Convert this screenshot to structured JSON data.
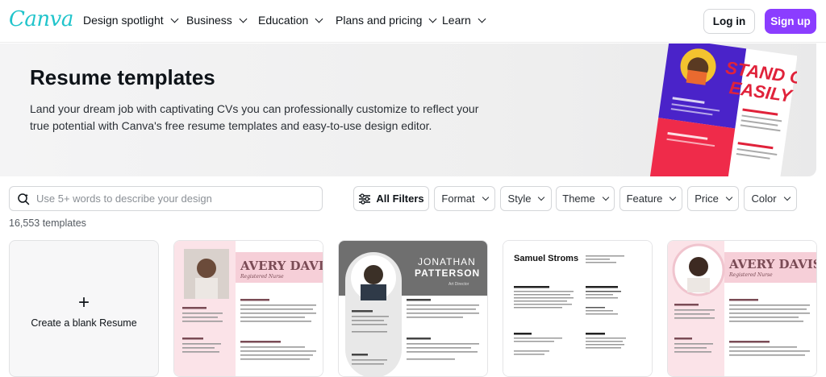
{
  "nav": {
    "logo": "Canva",
    "items": [
      {
        "label": "Design spotlight"
      },
      {
        "label": "Business"
      },
      {
        "label": "Education"
      },
      {
        "label": "Plans and pricing"
      },
      {
        "label": "Learn"
      }
    ],
    "login_label": "Log in",
    "signup_label": "Sign up",
    "accent_color": "#8b3dff"
  },
  "hero": {
    "title": "Resume templates",
    "description": "Land your dream job with captivating CVs you can professionally customize to reflect your true potential with Canva's free resume templates and easy-to-use design editor.",
    "art_text": [
      "STAND OUT",
      "EASILY"
    ]
  },
  "search": {
    "placeholder": "Use 5+ words to describe your design"
  },
  "filters": {
    "all_label": "All Filters",
    "items": [
      "Format",
      "Style",
      "Theme",
      "Feature",
      "Price",
      "Color"
    ]
  },
  "results": {
    "count_text": "16,553 templates"
  },
  "cards": {
    "blank_label": "Create a blank Resume",
    "templates": [
      {
        "name": "AVERY DAVIS",
        "subtitle": "Registered Nurse"
      },
      {
        "name_line1": "JONATHAN",
        "name_line2": "PATTERSON",
        "subtitle": "Art Director"
      },
      {
        "name": "Samuel Stroms"
      },
      {
        "name": "AVERY DAVIS",
        "subtitle": "Registered Nurse"
      }
    ]
  }
}
